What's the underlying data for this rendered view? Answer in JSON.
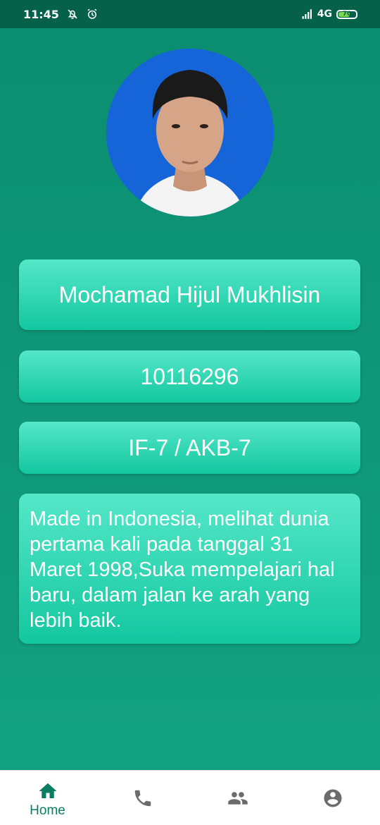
{
  "status_bar": {
    "time": "11:45",
    "network": "4G",
    "battery": "70",
    "icons": [
      "notifications-off-icon",
      "alarm-icon",
      "signal-icon",
      "battery-icon"
    ]
  },
  "profile": {
    "name": "Mochamad Hijul Mukhlisin",
    "nim": "10116296",
    "class": "IF-7 / AKB-7",
    "bio": "Made in Indonesia, melihat dunia pertama kali pada tanggal 31 Maret 1998,Suka mempelajari hal baru, dalam jalan ke arah yang lebih baik."
  },
  "bottom_nav": {
    "items": [
      {
        "icon": "home-icon",
        "label": "Home",
        "active": true
      },
      {
        "icon": "phone-icon",
        "active": false
      },
      {
        "icon": "people-icon",
        "active": false
      },
      {
        "icon": "account-icon",
        "active": false
      }
    ]
  },
  "colors": {
    "status_bar": "#05614a",
    "background": "#0e8e6f",
    "card": "#2fd6b0",
    "nav_active": "#0b7d63",
    "nav_inactive": "#6b6b6b"
  }
}
